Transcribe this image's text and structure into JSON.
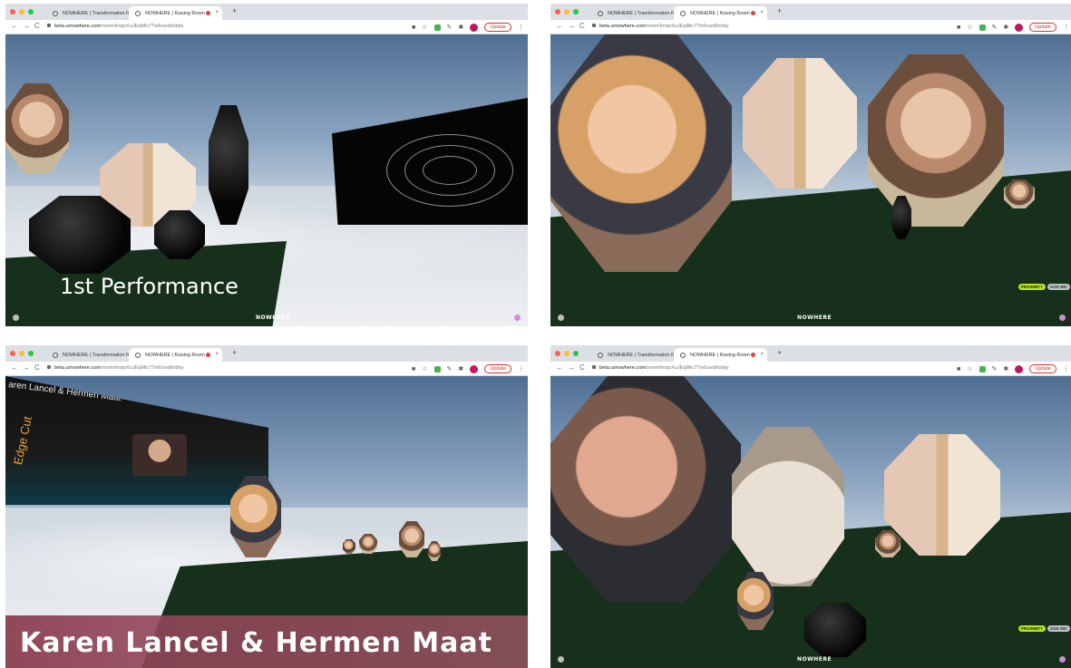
{
  "panels": [
    {
      "tabs": [
        {
          "label": "NOWHERE | Transformation R..."
        },
        {
          "label": "NOWHERE | Kissing Room"
        }
      ],
      "url": {
        "host": "beta.urnowhere.com",
        "path": "/room/lmqoXuJEqMic7Tiv6cwd/lobby"
      },
      "update_label": "Update",
      "brand": "NOWHERE",
      "overlay_title": "1st Performance"
    },
    {
      "tabs": [
        {
          "label": "NOWHERE | Transformation R..."
        },
        {
          "label": "NOWHERE | Kissing Room"
        }
      ],
      "url": {
        "host": "beta.urnowhere.com",
        "path": "/room/lmqoXuJEqMic7Tiv6cwd/lobby"
      },
      "update_label": "Update",
      "brand": "NOWHERE",
      "pills": [
        "PROXIMITY",
        "GOD MIC"
      ]
    },
    {
      "tabs": [
        {
          "label": "NOWHERE | Transformation R..."
        },
        {
          "label": "NOWHERE | Kissing Room"
        }
      ],
      "url": {
        "host": "beta.urnowhere.com",
        "path": "/room/lmqoXuJEqMic7Tiv6cwd/lobby"
      },
      "update_label": "Update",
      "screen_heading": "aren Lancel & Hermen Maat",
      "screen_side_text": "Edge Cut",
      "overlay_title": "Karen Lancel & Hermen Maat"
    },
    {
      "tabs": [
        {
          "label": "NOWHERE | Transformation R..."
        },
        {
          "label": "NOWHERE | Kissing Room"
        }
      ],
      "url": {
        "host": "beta.urnowhere.com",
        "path": "/room/lmqoXuJEqMic7Tiv6cwd/lobby"
      },
      "update_label": "Update",
      "brand": "NOWHERE",
      "pills": [
        "PROXIMITY",
        "GOD MIC"
      ]
    }
  ],
  "colors": {
    "accent": "#d93025",
    "pill_proximity": "#b5e61d",
    "pill_godmic": "#bfc3c7",
    "banner": "#8b3f52"
  },
  "icons": [
    "back-arrow-icon",
    "forward-arrow-icon",
    "reload-icon",
    "lock-icon",
    "camera-icon",
    "star-icon",
    "puzzle-icon",
    "menu-icon"
  ]
}
